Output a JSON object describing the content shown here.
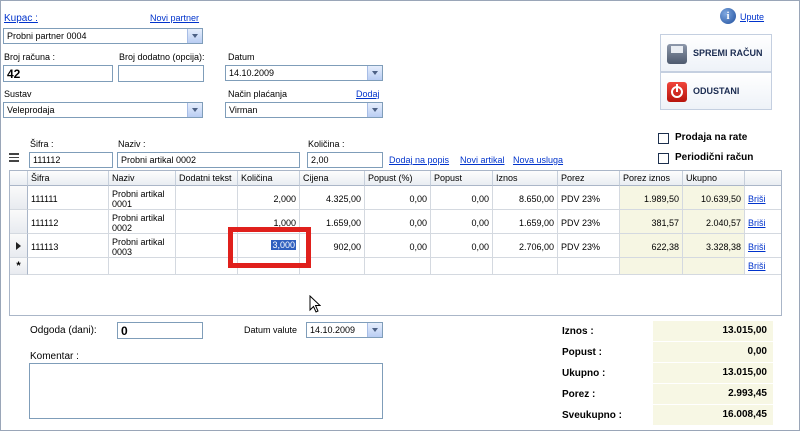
{
  "header": {
    "kupac_label": "Kupac :",
    "novi_partner_link": "Novi partner",
    "kupac_value": "Probni partner 0004",
    "upute_link": "Upute"
  },
  "form": {
    "broj_racuna_label": "Broj računa :",
    "broj_racuna_value": "42",
    "broj_dodatno_label": "Broj dodatno (opcija):",
    "broj_dodatno_value": "",
    "datum_label": "Datum",
    "datum_value": "14.10.2009",
    "sustav_label": "Sustav",
    "sustav_value": "Veleprodaja",
    "nacin_placanja_label": "Način plaćanja",
    "dodaj_link": "Dodaj",
    "nacin_placanja_value": "Virman"
  },
  "actions": {
    "spremi_label": "SPREMI RAČUN",
    "odustani_label": "ODUSTANI",
    "prodaja_na_rate_label": "Prodaja na rate",
    "periodicni_label": "Periodični račun"
  },
  "entry": {
    "sifra_label": "Šifra :",
    "sifra_value": "111112",
    "naziv_label": "Naziv :",
    "naziv_value": "Probni artikal 0002",
    "kolicina_label": "Količina :",
    "kolicina_value": "2,00",
    "dodaj_na_popis_link": "Dodaj na popis",
    "novi_artikal_link": "Novi artikal",
    "nova_usluga_link": "Nova usluga"
  },
  "grid": {
    "columns": [
      "Šifra",
      "Naziv",
      "Dodatni tekst",
      "Količina",
      "Cijena",
      "Popust (%)",
      "Popust",
      "Iznos",
      "Porez",
      "Porez iznos",
      "Ukupno"
    ],
    "rows": [
      {
        "sifra": "111111",
        "naziv": "Probni artikal 0001",
        "dodatni": "",
        "kolicina": "2,000",
        "cijena": "4.325,00",
        "popust_pct": "0,00",
        "popust": "0,00",
        "iznos": "8.650,00",
        "porez": "PDV 23%",
        "porez_iznos": "1.989,50",
        "ukupno": "10.639,50",
        "brisi": "Briši"
      },
      {
        "sifra": "111112",
        "naziv": "Probni artikal 0002",
        "dodatni": "",
        "kolicina": "1,000",
        "cijena": "1.659,00",
        "popust_pct": "0,00",
        "popust": "0,00",
        "iznos": "1.659,00",
        "porez": "PDV 23%",
        "porez_iznos": "381,57",
        "ukupno": "2.040,57",
        "brisi": "Briši"
      },
      {
        "sifra": "111113",
        "naziv": "Probni artikal 0003",
        "dodatni": "",
        "kolicina": "3,000",
        "cijena": "902,00",
        "popust_pct": "0,00",
        "popust": "0,00",
        "iznos": "2.706,00",
        "porez": "PDV 23%",
        "porez_iznos": "622,38",
        "ukupno": "3.328,38",
        "brisi": "Briši"
      }
    ],
    "new_row_marker": "*",
    "new_row_brisi": "Briši"
  },
  "footer": {
    "odgoda_label": "Odgoda (dani):",
    "odgoda_value": "0",
    "datum_valute_label": "Datum valute",
    "datum_valute_value": "14.10.2009",
    "komentar_label": "Komentar :",
    "komentar_value": ""
  },
  "totals": {
    "iznos_label": "Iznos :",
    "iznos_value": "13.015,00",
    "popust_label": "Popust :",
    "popust_value": "0,00",
    "ukupno_label": "Ukupno :",
    "ukupno_value": "13.015,00",
    "porez_label": "Porez :",
    "porez_value": "2.993,45",
    "sveukupno_label": "Sveukupno :",
    "sveukupno_value": "16.008,45"
  },
  "colors": {
    "link": "#0033cc",
    "highlight_box": "#e0201c",
    "save_icon": "#5e6b80",
    "cancel_icon": "#d9261c",
    "totals_bg": "#f7f7e4"
  }
}
